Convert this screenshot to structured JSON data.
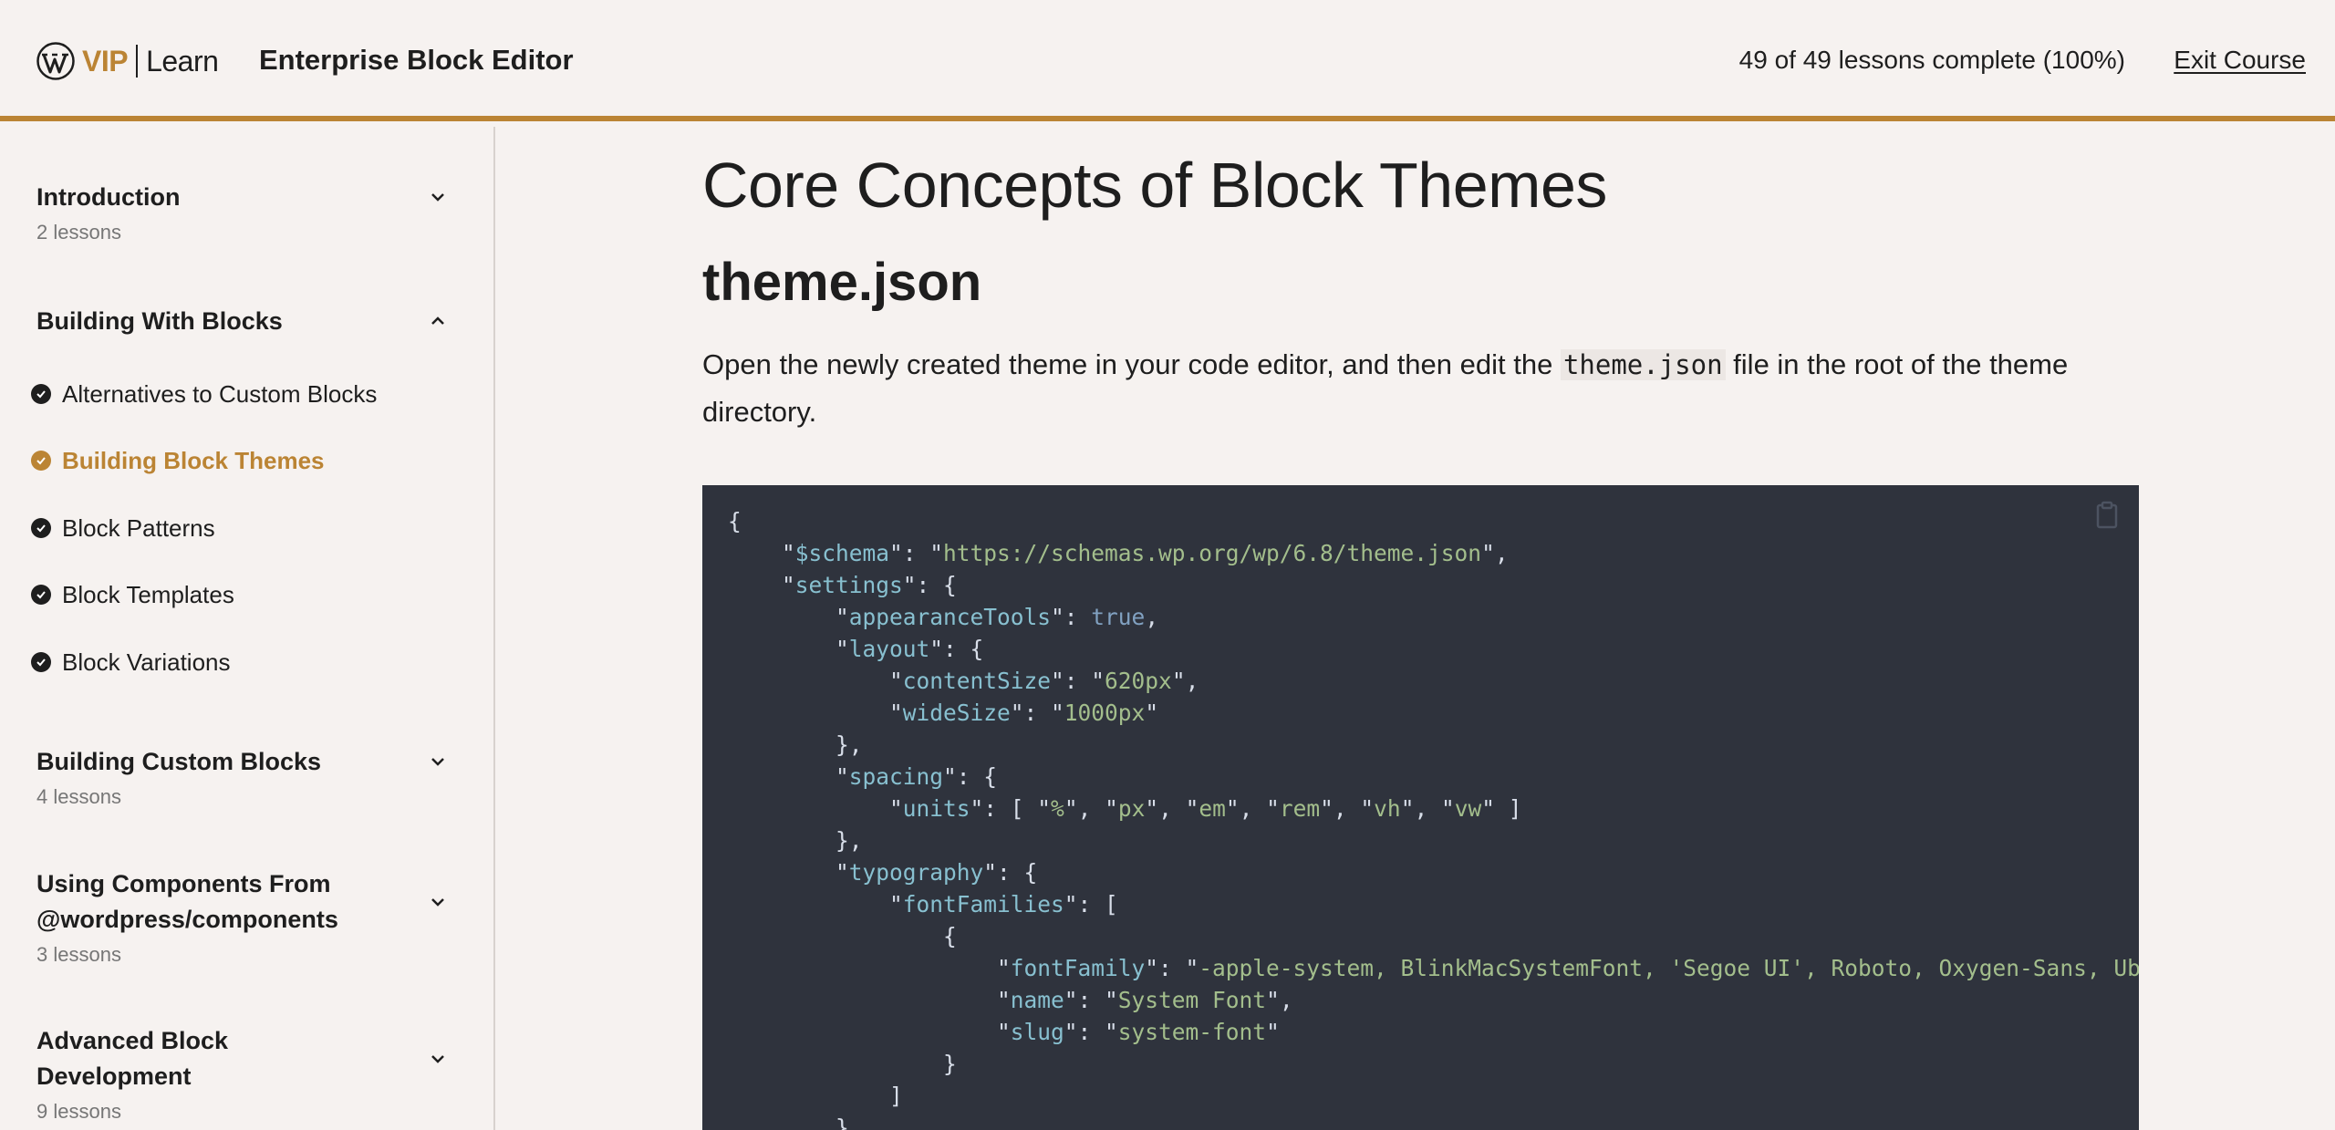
{
  "header": {
    "logo_vip": "VIP",
    "logo_learn": "Learn",
    "course_title": "Enterprise Block Editor",
    "progress": "49 of 49 lessons complete (100%)",
    "exit_label": "Exit Course"
  },
  "sidebar": {
    "sections": [
      {
        "title": "Introduction",
        "count": "2 lessons"
      },
      {
        "title": "Building With Blocks",
        "lessons": [
          {
            "label": "Alternatives to Custom Blocks"
          },
          {
            "label": "Building Block Themes"
          },
          {
            "label": "Block Patterns"
          },
          {
            "label": "Block Templates"
          },
          {
            "label": "Block Variations"
          }
        ]
      },
      {
        "title": "Building Custom Blocks",
        "count": "4 lessons"
      },
      {
        "title": "Using Components From @wordpress/components",
        "count": "3 lessons"
      },
      {
        "title": "Advanced Block Development",
        "count": "9 lessons"
      }
    ]
  },
  "main": {
    "title": "Core Concepts of Block Themes",
    "subtitle": "theme.json",
    "para_before": "Open the newly created theme in your code editor, and then edit the ",
    "para_code": "theme.json",
    "para_after": " file in the root of the theme directory.",
    "code": {
      "schema_url": "https://schemas.wp.org/wp/6.8/theme.json",
      "content_size": "620px",
      "wide_size": "1000px",
      "units": [
        "%",
        "px",
        "em",
        "rem",
        "vh",
        "vw"
      ],
      "font_family": "-apple-system, BlinkMacSystemFont, 'Segoe UI', Roboto, Oxygen-Sans, Ubu",
      "font_name": "System Font",
      "font_slug": "system-font"
    }
  }
}
